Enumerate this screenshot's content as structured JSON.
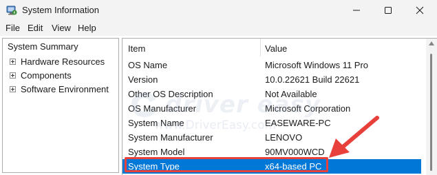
{
  "window": {
    "title": "System Information",
    "icon": "system-information-icon"
  },
  "menu": {
    "items": [
      "File",
      "Edit",
      "View",
      "Help"
    ]
  },
  "tree": {
    "root": "System Summary",
    "children": [
      {
        "label": "Hardware Resources",
        "icon": "plus-expander-icon"
      },
      {
        "label": "Components",
        "icon": "plus-expander-icon"
      },
      {
        "label": "Software Environment",
        "icon": "plus-expander-icon"
      }
    ]
  },
  "table": {
    "headers": [
      "Item",
      "Value"
    ],
    "rows": [
      {
        "item": "OS Name",
        "value": "Microsoft Windows 11 Pro"
      },
      {
        "item": "Version",
        "value": "10.0.22621 Build 22621"
      },
      {
        "item": "Other OS Description",
        "value": "Not Available"
      },
      {
        "item": "OS Manufacturer",
        "value": "Microsoft Corporation"
      },
      {
        "item": "System Name",
        "value": "EASEWARE-PC"
      },
      {
        "item": "System Manufacturer",
        "value": "LENOVO"
      },
      {
        "item": "System Model",
        "value": "90MV000WCD"
      },
      {
        "item": "System Type",
        "value": "x64-based PC"
      }
    ],
    "selected_row": 7
  },
  "watermark": {
    "brand": "driver easy",
    "url": "www.DriverEasy.com"
  },
  "colors": {
    "selection": "#0078d7",
    "highlight": "#e8413b",
    "chrome": "#f3f3f3"
  }
}
